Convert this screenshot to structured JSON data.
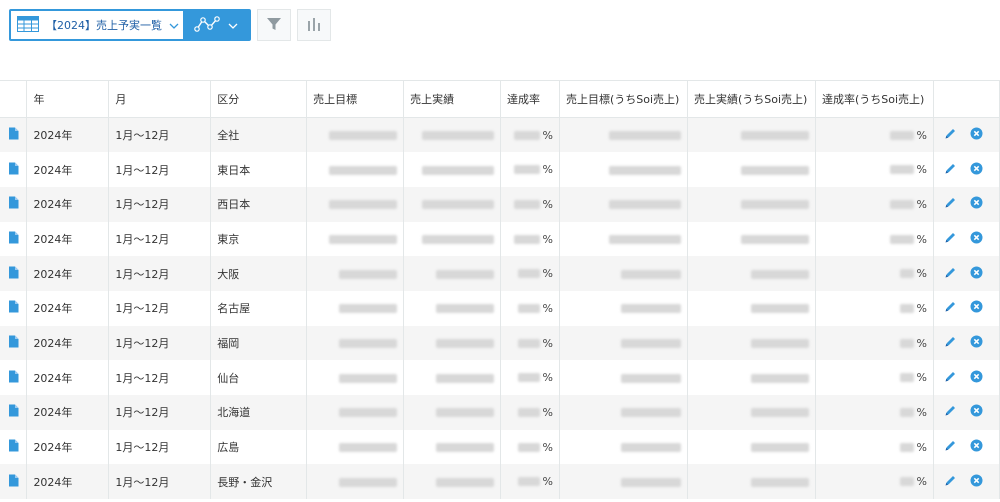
{
  "toolbar": {
    "view_label": "【2024】売上予実一覧",
    "icons": [
      "table-view-icon",
      "chevron-down-icon",
      "graph-icon",
      "filter-icon",
      "bar-chart-icon"
    ],
    "accent_color": "#3498db"
  },
  "table": {
    "headers": [
      "年",
      "月",
      "区分",
      "売上目標",
      "売上実績",
      "達成率",
      "売上目標(うちSoi売上)",
      "売上実績(うちSoi売上)",
      "達成率(うちSoi売上)"
    ],
    "percent_suffix": "%",
    "rows": [
      {
        "year": "2024年",
        "month": "1月～12月",
        "division": "全社"
      },
      {
        "year": "2024年",
        "month": "1月～12月",
        "division": "東日本"
      },
      {
        "year": "2024年",
        "month": "1月～12月",
        "division": "西日本"
      },
      {
        "year": "2024年",
        "month": "1月～12月",
        "division": "東京"
      },
      {
        "year": "2024年",
        "month": "1月～12月",
        "division": "大阪"
      },
      {
        "year": "2024年",
        "month": "1月～12月",
        "division": "名古屋"
      },
      {
        "year": "2024年",
        "month": "1月～12月",
        "division": "福岡"
      },
      {
        "year": "2024年",
        "month": "1月～12月",
        "division": "仙台"
      },
      {
        "year": "2024年",
        "month": "1月～12月",
        "division": "北海道"
      },
      {
        "year": "2024年",
        "month": "1月～12月",
        "division": "広島"
      },
      {
        "year": "2024年",
        "month": "1月～12月",
        "division": "長野・金沢"
      }
    ]
  }
}
